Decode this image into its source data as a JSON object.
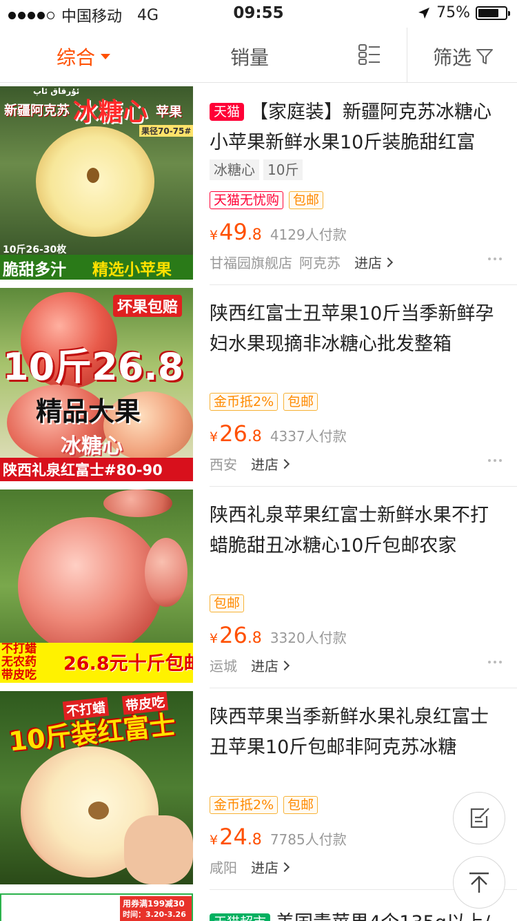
{
  "status_bar": {
    "carrier": "中国移动",
    "network": "4G",
    "time": "09:55",
    "battery": "75%",
    "battery_level": 0.75
  },
  "filter_bar": {
    "tab_comprehensive": "综合",
    "tab_sales": "销量",
    "tab_filter": "筛选"
  },
  "products": [
    {
      "shop_badge": "天猫",
      "title": "【家庭装】新疆阿克苏冰糖心小苹果新鲜水果10斤装脆甜红富",
      "keywords": [
        "冰糖心",
        "10斤"
      ],
      "tags": [
        "天猫无忧购",
        "包邮"
      ],
      "price_int": "49",
      "price_dec": ".8",
      "currency": "¥",
      "sold": "4129人付款",
      "shop": "甘福园旗舰店",
      "location": "阿克苏",
      "enter": "进店",
      "image_text": {
        "top_small": "ئۇرقاق ئاپ",
        "headline_a": "新疆阿克苏",
        "headline_b": "冰糖心",
        "headline_c": "苹果",
        "size": "果径70-75#",
        "count": "10斤26-30枚",
        "bottom_a": "脆甜多汁",
        "bottom_b": "精选小苹果"
      },
      "colors": {
        "tag1": "#ff0036",
        "tag2": "#ff8a00"
      }
    },
    {
      "shop_badge": "",
      "title": "陕西红富士丑苹果10斤当季新鲜孕妇水果现摘非冰糖心批发整箱",
      "keywords": [],
      "tags": [
        "金币抵2%",
        "包邮"
      ],
      "price_int": "26",
      "price_dec": ".8",
      "currency": "¥",
      "sold": "4337人付款",
      "shop": "",
      "location": "西安",
      "enter": "进店",
      "image_text": {
        "top": "坏果包赔",
        "big": "10斤26.8",
        "mid": "精品大果",
        "sub": "冰糖心",
        "bottom": "陕西礼泉红富士#80-90"
      }
    },
    {
      "shop_badge": "",
      "title": "陕西礼泉苹果红富士新鲜水果不打蜡脆甜丑冰糖心10斤包邮农家",
      "keywords": [],
      "tags": [
        "包邮"
      ],
      "price_int": "26",
      "price_dec": ".8",
      "currency": "¥",
      "sold": "3320人付款",
      "shop": "",
      "location": "运城",
      "enter": "进店",
      "image_text": {
        "left_line1": "不打蜡",
        "left_line2": "无农药",
        "left_line3": "带皮吃",
        "price": "26.8元十斤包邮"
      }
    },
    {
      "shop_badge": "",
      "title": "陕西苹果当季新鲜水果礼泉红富士丑苹果10斤包邮非阿克苏冰糖",
      "keywords": [],
      "tags": [
        "金币抵2%",
        "包邮"
      ],
      "price_int": "24",
      "price_dec": ".8",
      "currency": "¥",
      "sold": "7785人付款",
      "shop": "",
      "location": "咸阳",
      "enter": "进店",
      "image_text": {
        "top_a": "不打蜡",
        "top_b": "带皮吃",
        "headline": "10斤装红富士"
      }
    }
  ],
  "partial_item": {
    "shop_badge": "天猫超市",
    "title": "美国青苹果4个135g以上/",
    "image_text": {
      "line1": "用券满199减30",
      "line2": "时间：3.20-3.26"
    }
  },
  "icons": {
    "location": "location-arrow-icon",
    "layout": "grid-list-icon",
    "filter": "funnel-icon",
    "edit": "edit-note-icon",
    "top": "back-to-top-icon",
    "more": "more-dots-icon"
  },
  "colors": {
    "accent": "#ff5000",
    "tmall": "#ff0036",
    "chaoshi": "#00b060"
  }
}
